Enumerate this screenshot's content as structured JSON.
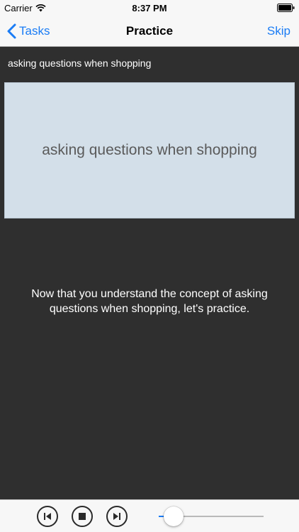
{
  "status_bar": {
    "carrier": "Carrier",
    "time": "8:37 PM",
    "wifi_icon": "wifi-icon",
    "battery_icon": "battery-icon"
  },
  "nav": {
    "back_label": "Tasks",
    "title": "Practice",
    "skip_label": "Skip",
    "accent_color": "#1a7cf5"
  },
  "topic": {
    "label": "asking questions when shopping",
    "card_text": "asking questions when shopping"
  },
  "instruction": "Now that you understand the concept of asking questions when shopping, let's practice.",
  "player": {
    "controls": [
      "previous-track-icon",
      "stop-icon",
      "next-track-icon"
    ],
    "progress": 0.06
  }
}
